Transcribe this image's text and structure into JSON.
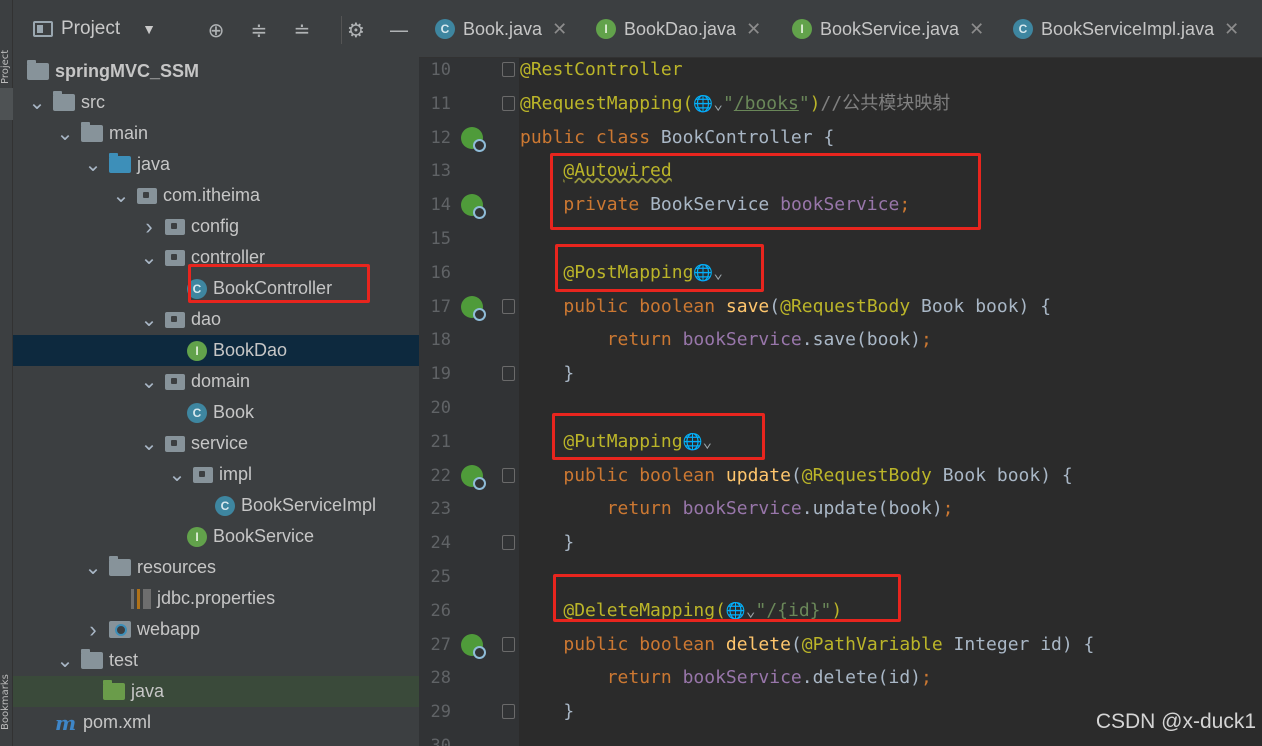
{
  "toolstrip": {
    "top_label": "Project",
    "bottom_label": "Bookmarks"
  },
  "project_panel": {
    "title": "Project",
    "toolbar_icons": [
      "crosshair-icon",
      "expand-all-icon",
      "collapse-all-icon",
      "gear-icon",
      "minimize-icon"
    ],
    "tree": [
      {
        "label": "springMVC_SSM",
        "icon": "module-folder-icon",
        "expanded": true
      },
      {
        "label": "src",
        "icon": "folder-icon",
        "expanded": true
      },
      {
        "label": "main",
        "icon": "folder-icon",
        "expanded": true
      },
      {
        "label": "java",
        "icon": "source-folder-icon",
        "expanded": true
      },
      {
        "label": "com.itheima",
        "icon": "package-icon",
        "expanded": true
      },
      {
        "label": "config",
        "icon": "package-icon",
        "expanded": false
      },
      {
        "label": "controller",
        "icon": "package-icon",
        "expanded": true
      },
      {
        "label": "BookController",
        "icon": "class-icon",
        "highlighted_box": true
      },
      {
        "label": "dao",
        "icon": "package-icon",
        "expanded": true
      },
      {
        "label": "BookDao",
        "icon": "interface-icon",
        "selected": true
      },
      {
        "label": "domain",
        "icon": "package-icon",
        "expanded": true
      },
      {
        "label": "Book",
        "icon": "class-icon"
      },
      {
        "label": "service",
        "icon": "package-icon",
        "expanded": true
      },
      {
        "label": "impl",
        "icon": "package-icon",
        "expanded": true
      },
      {
        "label": "BookServiceImpl",
        "icon": "class-icon"
      },
      {
        "label": "BookService",
        "icon": "interface-icon"
      },
      {
        "label": "resources",
        "icon": "resources-folder-icon",
        "expanded": true
      },
      {
        "label": "jdbc.properties",
        "icon": "properties-file-icon"
      },
      {
        "label": "webapp",
        "icon": "web-folder-icon",
        "expanded": false
      },
      {
        "label": "test",
        "icon": "folder-icon",
        "expanded": true
      },
      {
        "label": "java",
        "icon": "test-folder-icon"
      },
      {
        "label": "pom.xml",
        "icon": "maven-icon"
      }
    ]
  },
  "tabs": [
    {
      "label": "Book.java",
      "icon": "class-icon"
    },
    {
      "label": "BookDao.java",
      "icon": "interface-icon"
    },
    {
      "label": "BookService.java",
      "icon": "interface-icon"
    },
    {
      "label": "BookServiceImpl.java",
      "icon": "class-icon"
    }
  ],
  "editor": {
    "lines": [
      {
        "n": "10",
        "parts": [
          {
            "t": "@RestController",
            "c": "ann"
          }
        ]
      },
      {
        "n": "11",
        "parts": [
          {
            "t": "@RequestMapping(",
            "c": "ann"
          },
          {
            "t": "🌐⌄",
            "c": "globe"
          },
          {
            "t": "\"",
            "c": "str"
          },
          {
            "t": "/books",
            "c": "str u"
          },
          {
            "t": "\"",
            "c": "str"
          },
          {
            "t": ")",
            "c": "ann"
          },
          {
            "t": "//公共模块映射",
            "c": "cm"
          }
        ]
      },
      {
        "n": "12",
        "parts": [
          {
            "t": "public class ",
            "c": "kw"
          },
          {
            "t": "BookController {",
            "c": "txt"
          }
        ]
      },
      {
        "n": "13",
        "parts": [
          {
            "t": "    "
          },
          {
            "t": "@Autowired",
            "c": "ann wavy"
          }
        ]
      },
      {
        "n": "14",
        "parts": [
          {
            "t": "    "
          },
          {
            "t": "private ",
            "c": "kw"
          },
          {
            "t": "BookService ",
            "c": "txt"
          },
          {
            "t": "bookService",
            "c": "fld"
          },
          {
            "t": ";",
            "c": "kw"
          }
        ]
      },
      {
        "n": "15",
        "parts": []
      },
      {
        "n": "16",
        "parts": [
          {
            "t": "    "
          },
          {
            "t": "@PostMapping",
            "c": "ann"
          },
          {
            "t": "🌐⌄",
            "c": "globe"
          }
        ]
      },
      {
        "n": "17",
        "parts": [
          {
            "t": "    "
          },
          {
            "t": "public boolean ",
            "c": "kw"
          },
          {
            "t": "save",
            "c": "fn"
          },
          {
            "t": "(",
            "c": "txt"
          },
          {
            "t": "@RequestBody ",
            "c": "ann"
          },
          {
            "t": "Book book) {",
            "c": "txt"
          }
        ]
      },
      {
        "n": "18",
        "parts": [
          {
            "t": "        "
          },
          {
            "t": "return ",
            "c": "kw"
          },
          {
            "t": "bookService",
            "c": "fld"
          },
          {
            "t": ".save(book)",
            "c": "txt"
          },
          {
            "t": ";",
            "c": "kw"
          }
        ]
      },
      {
        "n": "19",
        "parts": [
          {
            "t": "    "
          },
          {
            "t": "}",
            "c": "txt"
          }
        ]
      },
      {
        "n": "20",
        "parts": []
      },
      {
        "n": "21",
        "parts": [
          {
            "t": "    "
          },
          {
            "t": "@PutMapping",
            "c": "ann"
          },
          {
            "t": "🌐⌄",
            "c": "globe"
          }
        ]
      },
      {
        "n": "22",
        "parts": [
          {
            "t": "    "
          },
          {
            "t": "public boolean ",
            "c": "kw"
          },
          {
            "t": "update",
            "c": "fn"
          },
          {
            "t": "(",
            "c": "txt"
          },
          {
            "t": "@RequestBody ",
            "c": "ann"
          },
          {
            "t": "Book book) {",
            "c": "txt"
          }
        ]
      },
      {
        "n": "23",
        "parts": [
          {
            "t": "        "
          },
          {
            "t": "return ",
            "c": "kw"
          },
          {
            "t": "bookService",
            "c": "fld"
          },
          {
            "t": ".update(book)",
            "c": "txt"
          },
          {
            "t": ";",
            "c": "kw"
          }
        ]
      },
      {
        "n": "24",
        "parts": [
          {
            "t": "    "
          },
          {
            "t": "}",
            "c": "txt"
          }
        ]
      },
      {
        "n": "25",
        "parts": []
      },
      {
        "n": "26",
        "parts": [
          {
            "t": "    "
          },
          {
            "t": "@DeleteMapping(",
            "c": "ann"
          },
          {
            "t": "🌐⌄",
            "c": "globe"
          },
          {
            "t": "\"/{id}\"",
            "c": "str"
          },
          {
            "t": ")",
            "c": "ann"
          }
        ]
      },
      {
        "n": "27",
        "parts": [
          {
            "t": "    "
          },
          {
            "t": "public boolean ",
            "c": "kw"
          },
          {
            "t": "delete",
            "c": "fn"
          },
          {
            "t": "(",
            "c": "txt"
          },
          {
            "t": "@PathVariable ",
            "c": "ann"
          },
          {
            "t": "Integer id) {",
            "c": "txt"
          }
        ]
      },
      {
        "n": "28",
        "parts": [
          {
            "t": "        "
          },
          {
            "t": "return ",
            "c": "kw"
          },
          {
            "t": "bookService",
            "c": "fld"
          },
          {
            "t": ".delete(id)",
            "c": "txt"
          },
          {
            "t": ";",
            "c": "kw"
          }
        ]
      },
      {
        "n": "29",
        "parts": [
          {
            "t": "    "
          },
          {
            "t": "}",
            "c": "txt"
          }
        ]
      },
      {
        "n": "30",
        "parts": []
      }
    ]
  },
  "watermark": "CSDN @x-duck1",
  "colors": {
    "annotation": "#bbb529",
    "keyword": "#cc7832",
    "string": "#6a8759",
    "field": "#9876aa",
    "method": "#ffc66d",
    "comment": "#808080",
    "highlight_box": "#e8251e"
  }
}
